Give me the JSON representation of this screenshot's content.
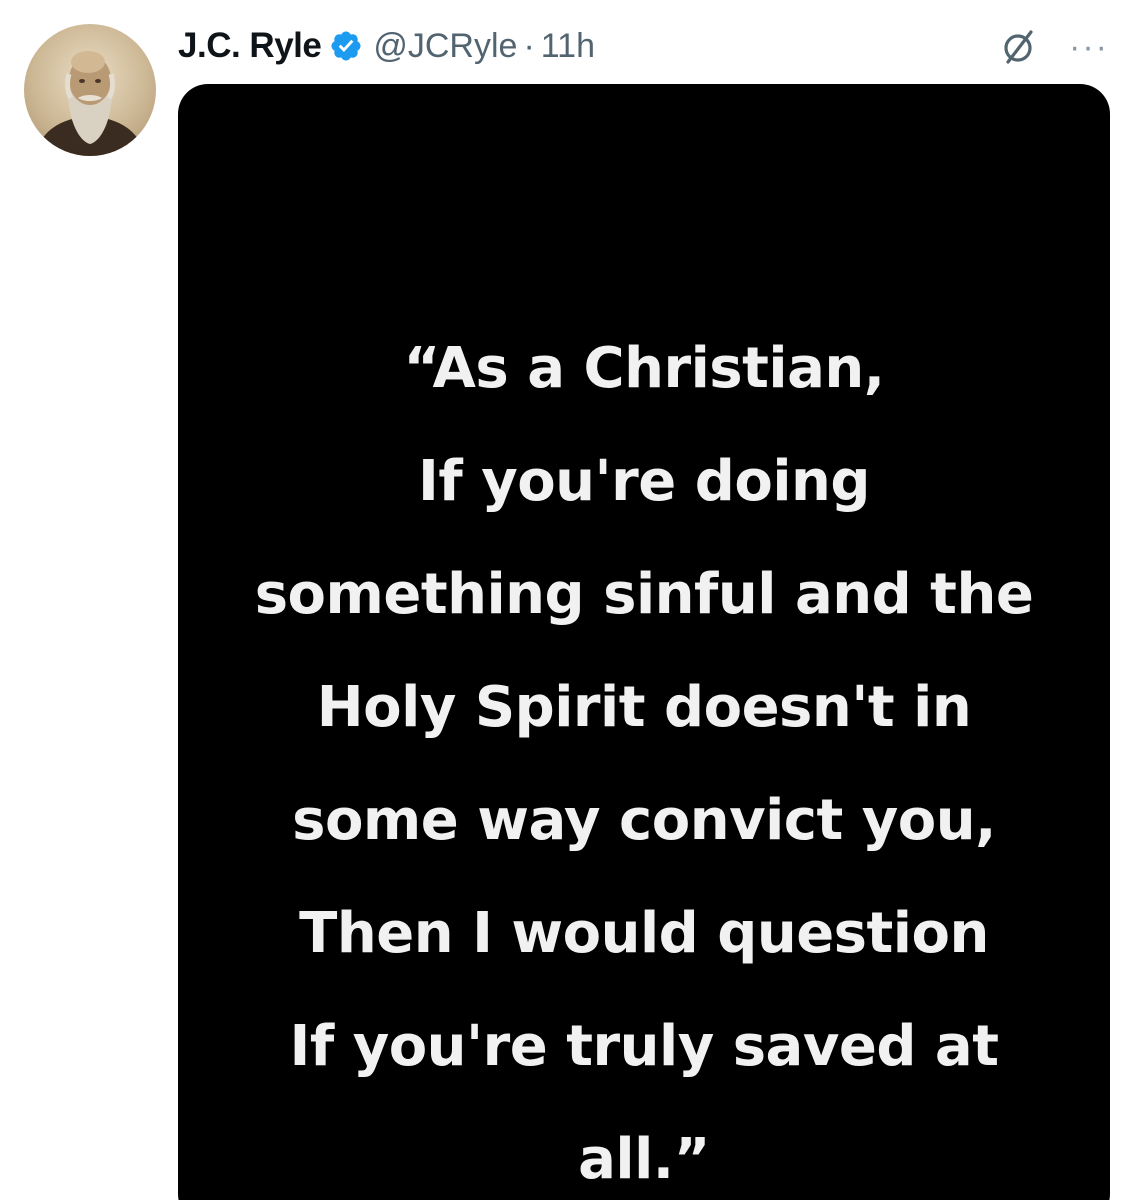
{
  "tweet": {
    "display_name": "J.C. Ryle",
    "handle": "@JCRyle",
    "separator": "·",
    "time": "11h",
    "verified_color": "#1d9bf0",
    "icons": {
      "verified": "verified-badge-icon",
      "grok": "grok-icon",
      "more": "more-options-icon"
    },
    "more_glyph": "···"
  },
  "media": {
    "background": "#000000",
    "quote_lines": [
      "“As a Christian,",
      "If you're doing",
      "something sinful and the",
      "Holy Spirit doesn't in",
      "some way convict you,",
      "Then I would question",
      "If you're truly saved at",
      "all.”"
    ]
  }
}
